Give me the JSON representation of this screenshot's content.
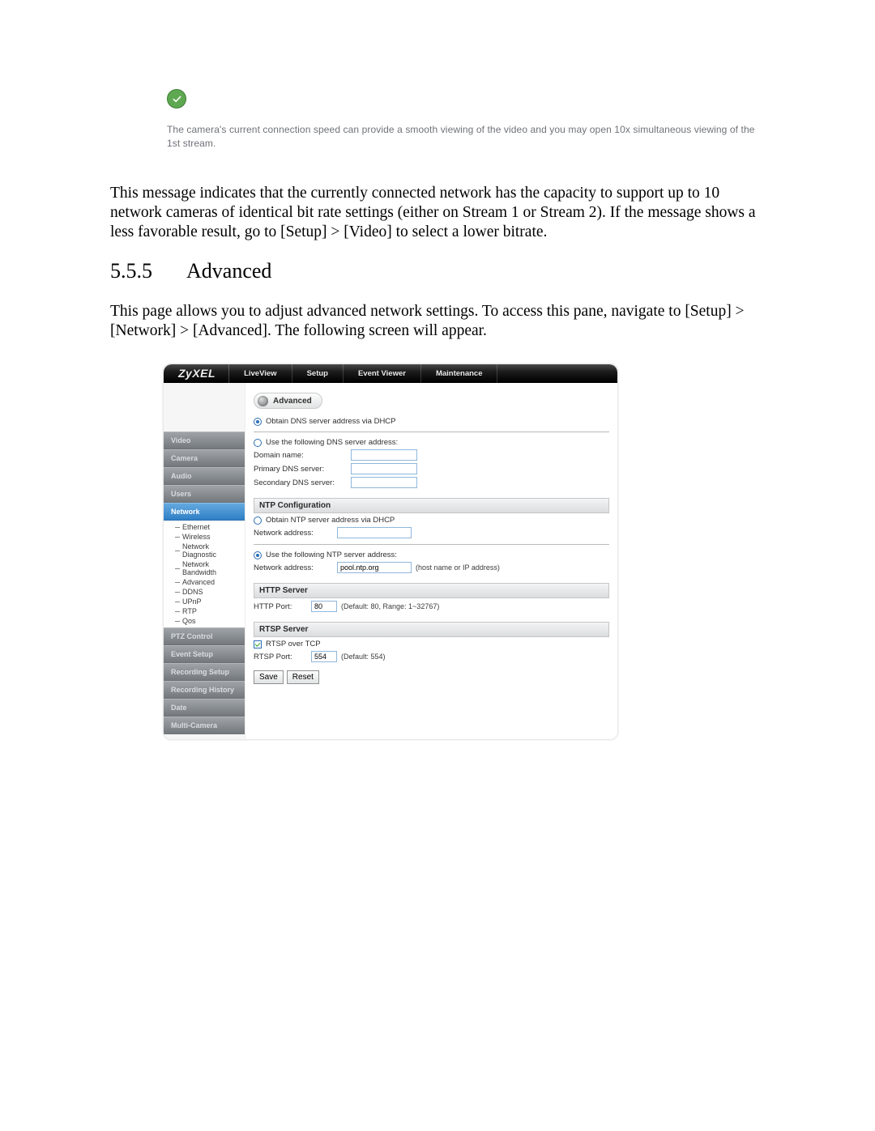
{
  "check_message": {
    "text": "The camera's current connection speed can provide a smooth viewing of the video and you may open 10x simultaneous viewing of the 1st stream."
  },
  "paragraph1": "This message indicates that the currently connected network has the capacity to support up to 10 network cameras of identical bit rate settings (either on Stream 1 or Stream 2). If the message shows a less favorable result, go to [Setup] > [Video] to select a lower bitrate.",
  "section": {
    "number": "5.5.5",
    "title": "Advanced"
  },
  "paragraph2": "This page allows you to adjust advanced network settings. To access this pane, navigate to [Setup] > [Network] > [Advanced]. The following screen will appear.",
  "ui": {
    "brand": "ZyXEL",
    "nav": {
      "liveview": "LiveView",
      "setup": "Setup",
      "eventviewer": "Event Viewer",
      "maintenance": "Maintenance"
    },
    "sidebar": {
      "video": "Video",
      "camera": "Camera",
      "audio": "Audio",
      "users": "Users",
      "network": "Network",
      "ptz": "PTZ Control",
      "event": "Event Setup",
      "recsetup": "Recording Setup",
      "rechist": "Recording History",
      "date": "Date",
      "multicam": "Multi-Camera",
      "sub": {
        "ethernet": "Ethernet",
        "wireless": "Wireless",
        "netdiag": "Network Diagnostic",
        "netbw": "Network Bandwidth",
        "advanced": "Advanced",
        "ddns": "DDNS",
        "upnp": "UPnP",
        "rtp": "RTP",
        "qos": "Qos"
      }
    },
    "advanced": {
      "button": "Advanced",
      "dns_dhcp": "Obtain DNS server address via DHCP",
      "dns_manual": "Use the following DNS server address:",
      "domain_name_label": "Domain name:",
      "primary_dns_label": "Primary DNS server:",
      "secondary_dns_label": "Secondary DNS server:",
      "ntp_section": "NTP Configuration",
      "ntp_dhcp": "Obtain NTP server address via DHCP",
      "ntp_addr_label_1": "Network address:",
      "ntp_manual": "Use the following NTP server address:",
      "ntp_addr_label_2": "Network address:",
      "ntp_value": "pool.ntp.org",
      "ntp_hint": "(host name or IP address)",
      "http_section": "HTTP Server",
      "http_port_label": "HTTP Port:",
      "http_port_value": "80",
      "http_port_hint": "(Default: 80, Range: 1~32767)",
      "rtsp_section": "RTSP Server",
      "rtsp_tcp": "RTSP over TCP",
      "rtsp_port_label": "RTSP Port:",
      "rtsp_port_value": "554",
      "rtsp_port_hint": "(Default: 554)",
      "save": "Save",
      "reset": "Reset"
    }
  }
}
